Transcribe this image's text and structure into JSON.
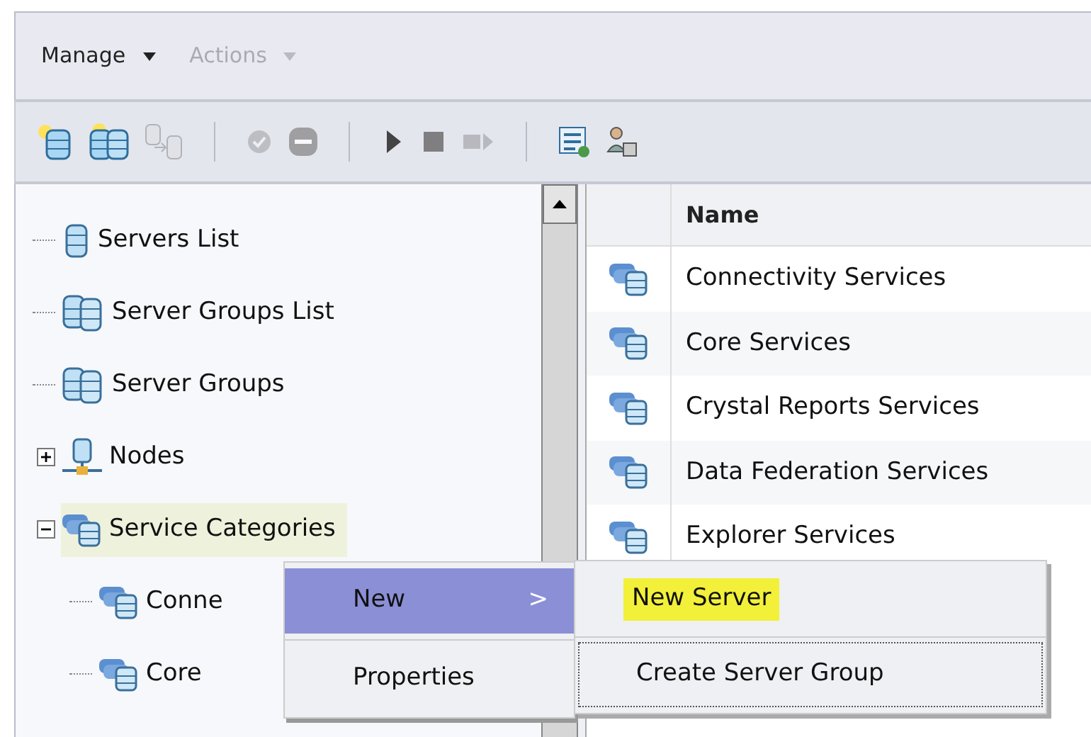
{
  "menu_bar": [
    {
      "label": "Manage",
      "disabled": false
    },
    {
      "label": "Actions",
      "disabled": true
    }
  ],
  "toolbar": [
    {
      "kind": "new-server",
      "disabled": false
    },
    {
      "kind": "new-group",
      "disabled": false
    },
    {
      "kind": "move",
      "disabled": true
    },
    {
      "kind": "separator"
    },
    {
      "kind": "enable",
      "disabled": true
    },
    {
      "kind": "disable",
      "disabled": false
    },
    {
      "kind": "separator"
    },
    {
      "kind": "start",
      "disabled": false
    },
    {
      "kind": "stop",
      "disabled": false
    },
    {
      "kind": "restart",
      "disabled": true
    },
    {
      "kind": "separator"
    },
    {
      "kind": "properties",
      "disabled": false
    },
    {
      "kind": "users",
      "disabled": false
    }
  ],
  "tree": [
    {
      "label": "Servers List",
      "kind": "server",
      "selected": false
    },
    {
      "label": "Server Groups List",
      "kind": "group",
      "selected": false
    },
    {
      "label": "Server Groups",
      "kind": "group",
      "selected": false
    },
    {
      "label": "Nodes",
      "kind": "node",
      "selected": false,
      "expanded": false
    },
    {
      "label": "Service Categories",
      "kind": "category",
      "selected": true,
      "expanded": true,
      "children": [
        {
          "label": "Conne",
          "kind": "category",
          "selected": false
        },
        {
          "label": "Core",
          "kind": "category",
          "selected": false
        }
      ]
    }
  ],
  "table": {
    "columns": [
      "Name"
    ],
    "rows": [
      {
        "name": "Connectivity Services",
        "covered": false
      },
      {
        "name": "Core Services",
        "covered": false
      },
      {
        "name": "Crystal Reports Services",
        "covered": false
      },
      {
        "name": "Data Federation Services",
        "covered": false
      },
      {
        "name": "Explorer Services",
        "covered": false
      }
    ]
  },
  "context_menu": {
    "items": [
      {
        "label": "New",
        "selected": true,
        "submenu_arrow": ">"
      },
      {
        "label": "Properties",
        "selected": false
      }
    ]
  },
  "submenu": {
    "items": [
      {
        "label": "New Server",
        "highlighted": true,
        "focused": false
      },
      {
        "label": "Create Server Group",
        "highlighted": false,
        "focused": true
      }
    ]
  }
}
